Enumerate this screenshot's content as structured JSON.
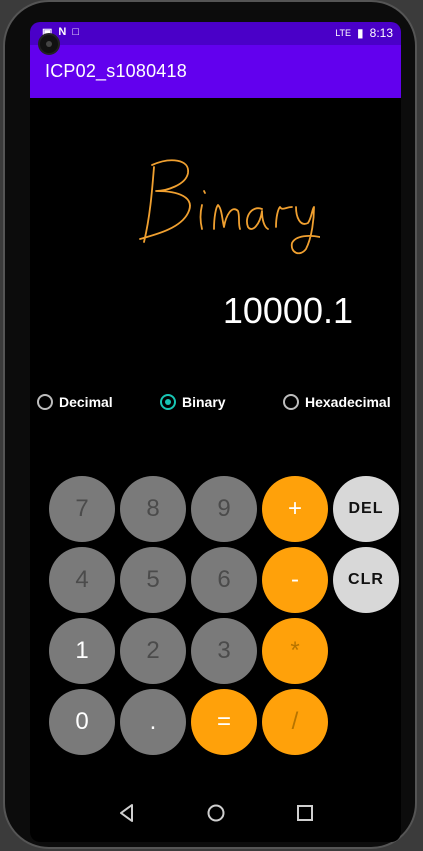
{
  "status_bar": {
    "left_icons": [
      "sd-card-icon",
      "n-icon",
      "a-icon"
    ],
    "time": "8:13",
    "signal": "LTE"
  },
  "app_bar": {
    "title": "ICP02_s1080418"
  },
  "signature_text": "Binary",
  "display": {
    "value": "10000.1"
  },
  "radio_options": [
    {
      "label": "Decimal",
      "checked": false
    },
    {
      "label": "Binary",
      "checked": true
    },
    {
      "label": "Hexadecimal",
      "checked": false
    }
  ],
  "keypad": {
    "row1": [
      "7",
      "8",
      "9",
      "+",
      "DEL"
    ],
    "row2": [
      "4",
      "5",
      "6",
      "-",
      "CLR"
    ],
    "row3": [
      "1",
      "2",
      "3",
      "*"
    ],
    "row4": [
      "0",
      ".",
      "=",
      "/"
    ]
  },
  "colors": {
    "status_bar": "#4a00c8",
    "app_bar": "#6200ee",
    "digit_button": "#7a7a7a",
    "operator_button": "#ffa10a",
    "control_button": "#d8d8d8",
    "radio_accent": "#18c6b4",
    "signature": "#f0a030"
  }
}
